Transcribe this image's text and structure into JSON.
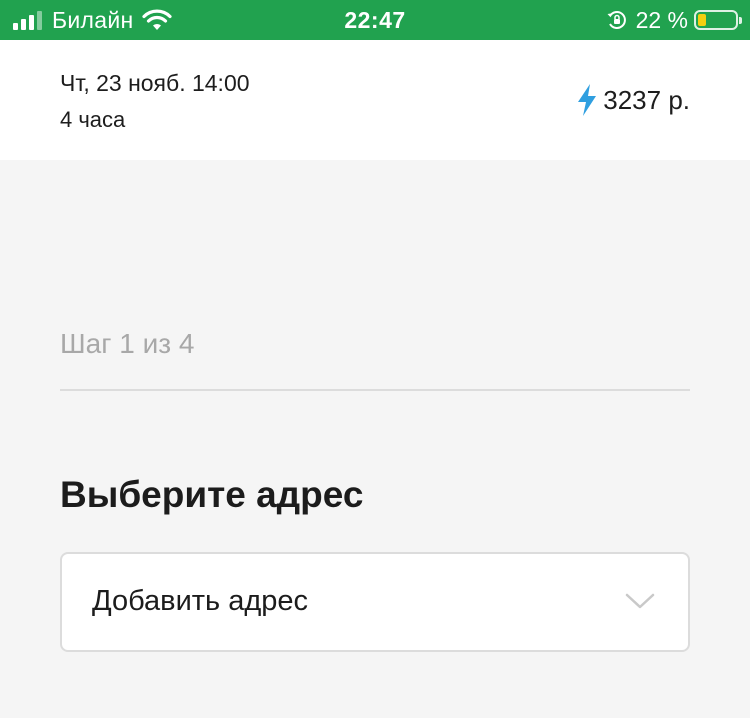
{
  "status_bar": {
    "carrier": "Билайн",
    "time": "22:47",
    "battery_percent": "22 %",
    "battery_level": 0.22,
    "icons": [
      "signal-icon",
      "wifi-icon",
      "orientation-lock-icon",
      "battery-icon"
    ],
    "colors": {
      "background": "#21a24f",
      "battery_fill": "#f4cf10"
    }
  },
  "summary": {
    "date": "Чт, 23 нояб. 14:00",
    "duration": "4 часа",
    "price": "3237 р.",
    "price_icon": "lightning-bolt-icon",
    "accent_color": "#2f9fe0"
  },
  "step": {
    "label": "Шаг 1 из 4"
  },
  "address": {
    "title": "Выберите адрес",
    "select_value": "Добавить адрес",
    "select_icon": "chevron-down-icon"
  }
}
